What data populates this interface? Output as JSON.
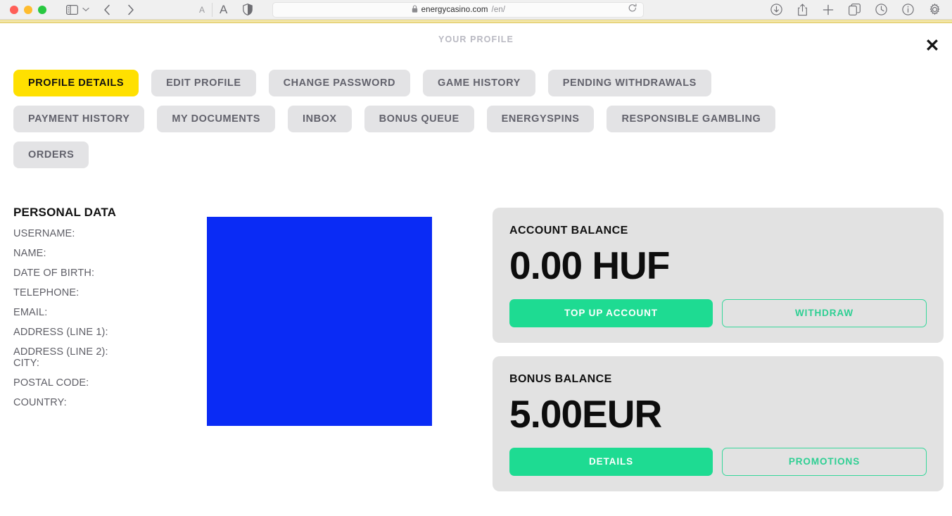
{
  "browser": {
    "url_host": "energycasino.com",
    "url_path": "/en/",
    "icons": {
      "lock": "lock-icon",
      "reload": "reload-icon",
      "sidebar": "sidebar-toggle-icon",
      "chevron_down": "chevron-down-icon",
      "back": "back-arrow-icon",
      "forward": "forward-arrow-icon",
      "text_small": "A",
      "text_large": "A",
      "shield": "privacy-shield-icon",
      "download": "download-icon",
      "share": "share-icon",
      "new_tab": "plus-icon",
      "tab_overview": "tab-overview-icon",
      "history": "history-clock-icon",
      "info": "info-icon",
      "settings": "gear-icon"
    }
  },
  "header": {
    "title": "YOUR PROFILE",
    "close_label": "✕"
  },
  "tabs": [
    {
      "label": "PROFILE DETAILS",
      "active": true
    },
    {
      "label": "EDIT PROFILE",
      "active": false
    },
    {
      "label": "CHANGE PASSWORD",
      "active": false
    },
    {
      "label": "GAME HISTORY",
      "active": false
    },
    {
      "label": "PENDING WITHDRAWALS",
      "active": false
    },
    {
      "label": "PAYMENT HISTORY",
      "active": false
    },
    {
      "label": "MY DOCUMENTS",
      "active": false
    },
    {
      "label": "INBOX",
      "active": false
    },
    {
      "label": "BONUS QUEUE",
      "active": false
    },
    {
      "label": "ENERGYSPINS",
      "active": false
    },
    {
      "label": "RESPONSIBLE GAMBLING",
      "active": false
    },
    {
      "label": "ORDERS",
      "active": false
    }
  ],
  "personal_data": {
    "title": "PERSONAL DATA",
    "fields": [
      {
        "label": "USERNAME:",
        "value": ""
      },
      {
        "label": "NAME:",
        "value": ""
      },
      {
        "label": "DATE OF BIRTH:",
        "value": ""
      },
      {
        "label": "TELEPHONE:",
        "value": ""
      },
      {
        "label": "EMAIL:",
        "value": ""
      },
      {
        "label": "ADDRESS (LINE 1):",
        "value": ""
      },
      {
        "label": "ADDRESS (LINE 2):",
        "value": ""
      },
      {
        "label": "CITY:",
        "value": ""
      },
      {
        "label": "POSTAL CODE:",
        "value": ""
      },
      {
        "label": "COUNTRY:",
        "value": ""
      }
    ]
  },
  "redaction_block": {
    "name": "redacted-image-block",
    "color": "#0a2bf5"
  },
  "cards": [
    {
      "label": "ACCOUNT BALANCE",
      "amount": "0.00 HUF",
      "primary_button": "TOP UP ACCOUNT",
      "secondary_button": "WITHDRAW"
    },
    {
      "label": "BONUS BALANCE",
      "amount": "5.00EUR",
      "primary_button": "DETAILS",
      "secondary_button": "PROMOTIONS"
    }
  ],
  "colors": {
    "accent_yellow": "#ffe000",
    "accent_green": "#1edb92",
    "card_bg": "#e2e2e2",
    "tab_bg": "#e3e3e5",
    "redaction_blue": "#0a2bf5"
  }
}
